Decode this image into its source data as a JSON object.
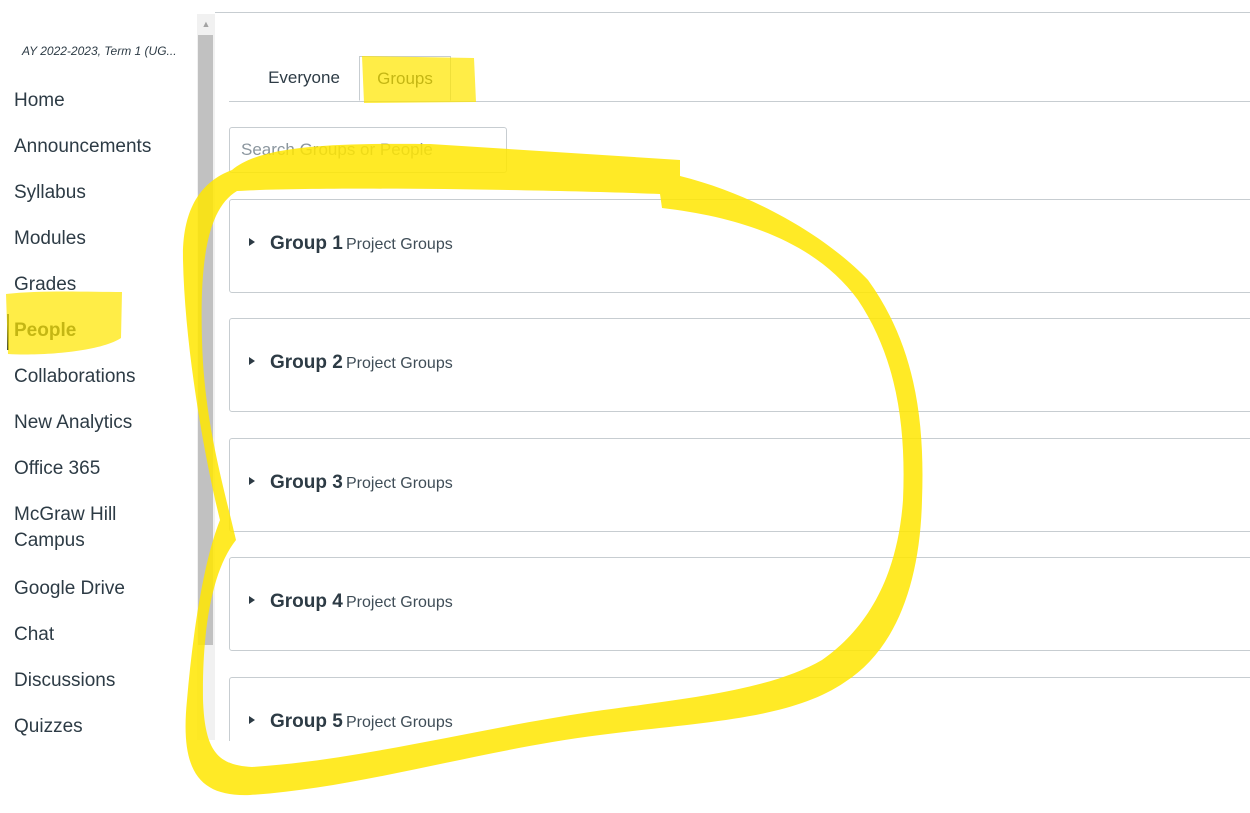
{
  "course_nav": {
    "term": "AY 2022-2023, Term 1 (UG...",
    "items": [
      {
        "label": "Home"
      },
      {
        "label": "Announcements"
      },
      {
        "label": "Syllabus"
      },
      {
        "label": "Modules"
      },
      {
        "label": "Grades"
      },
      {
        "label": "People",
        "active": true
      },
      {
        "label": "Collaborations"
      },
      {
        "label": "New Analytics"
      },
      {
        "label": "Office 365"
      },
      {
        "label": "McGraw Hill Campus"
      },
      {
        "label": "Google Drive"
      },
      {
        "label": "Chat"
      },
      {
        "label": "Discussions"
      },
      {
        "label": "Quizzes"
      }
    ]
  },
  "tabs": {
    "everyone": "Everyone",
    "groups": "Groups",
    "selected": "Groups"
  },
  "search": {
    "placeholder": "Search Groups or People",
    "value": ""
  },
  "groups": [
    {
      "name": "Group 1",
      "category": "Project Groups"
    },
    {
      "name": "Group 2",
      "category": "Project Groups"
    },
    {
      "name": "Group 3",
      "category": "Project Groups"
    },
    {
      "name": "Group 4",
      "category": "Project Groups"
    },
    {
      "name": "Group 5",
      "category": "Project Groups"
    }
  ],
  "annotation": {
    "color": "#ffe600",
    "marks": [
      "highlight-groups-tab",
      "highlight-people-nav",
      "circle-around-groups"
    ]
  },
  "colors": {
    "text": "#2d3b45",
    "border": "#c7cdd1"
  },
  "icons": [
    "caret-right-icon",
    "scroll-up-arrow-icon"
  ]
}
